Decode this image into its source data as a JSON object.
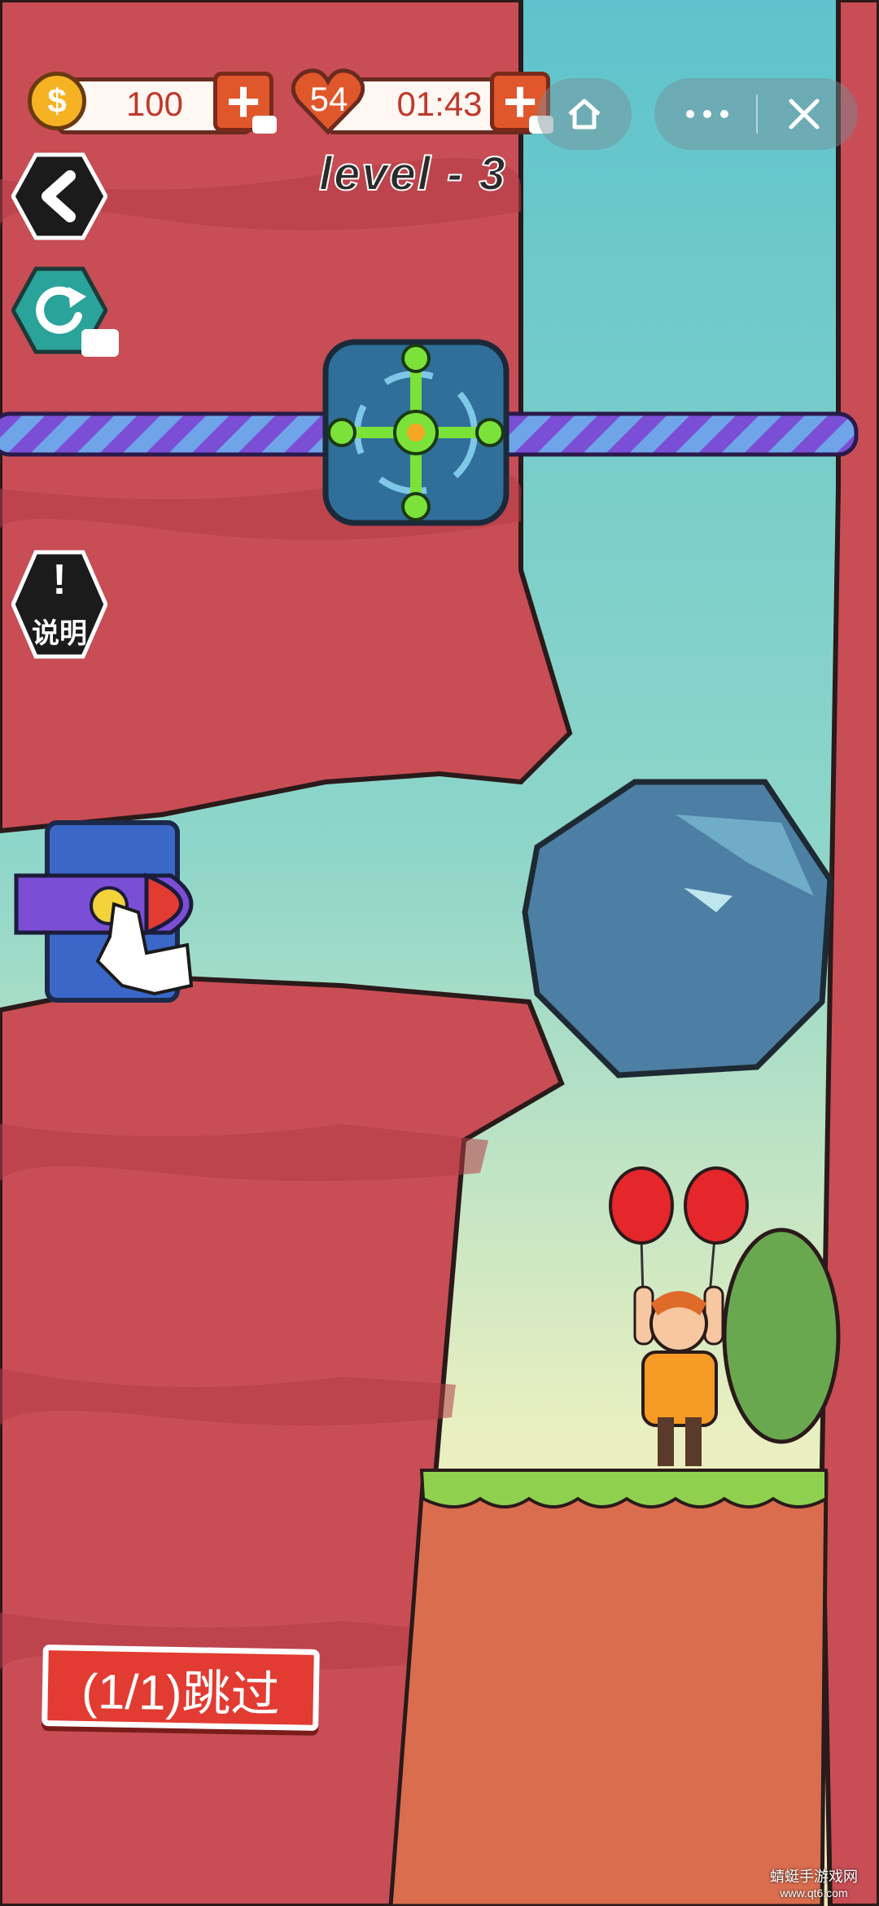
{
  "hud": {
    "coins": "100",
    "lives": "54",
    "timer": "01:43",
    "plus": "+"
  },
  "level_label": "level - 3",
  "buttons": {
    "back_icon": "back-arrow-icon",
    "restart_icon": "restart-icon",
    "info_mark": "!",
    "info_label": "说明",
    "home_icon": "home-icon",
    "more_icon": "more-icon",
    "close_icon": "close-icon",
    "skip_label": "(1/1)跳过"
  },
  "watermark": {
    "line1": "蜻蜓手游戏网",
    "line2": "www.qt6.com"
  },
  "colors": {
    "rock_wall": "#c94d55",
    "sky": "#6ecfd4",
    "ground": "#d96d4e",
    "grass": "#8fd14f",
    "boulder": "#4c7fa3",
    "pin": "#7a4dd8",
    "accent_orange": "#e0572b"
  }
}
